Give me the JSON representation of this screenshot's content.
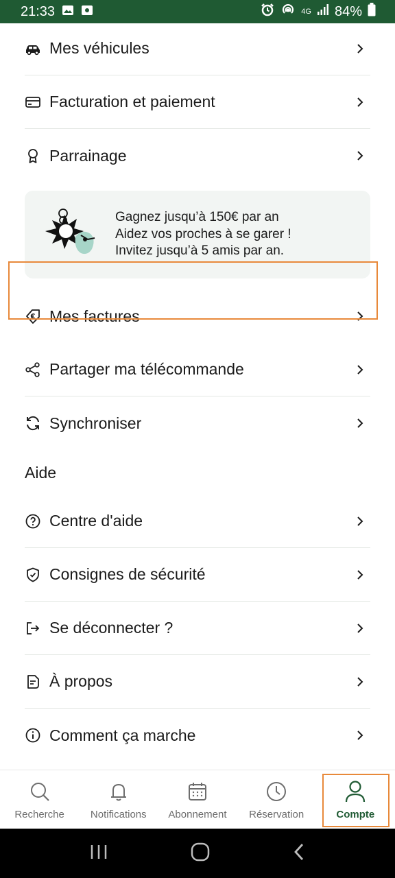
{
  "statusbar": {
    "time": "21:33",
    "network": "4G",
    "battery": "84%"
  },
  "menu": {
    "vehicles": "Mes véhicules",
    "billing": "Facturation et paiement",
    "referral": "Parrainage",
    "invoices": "Mes factures",
    "share_remote": "Partager ma télécommande",
    "sync": "Synchroniser"
  },
  "promo": {
    "line1": "Gagnez jusqu’à 150€ par an",
    "line2": "Aidez vos proches à se garer !",
    "line3": "Invitez jusqu’à 5 amis par an."
  },
  "help": {
    "title": "Aide",
    "center": "Centre d'aide",
    "safety": "Consignes de sécurité",
    "logout": "Se déconnecter ?",
    "about": "À propos",
    "how": "Comment ça marche"
  },
  "bottomnav": {
    "search": "Recherche",
    "notifications": "Notifications",
    "subscription": "Abonnement",
    "reservation": "Réservation",
    "account": "Compte"
  },
  "colors": {
    "brand": "#1f5a33",
    "highlight": "#e8893a",
    "accent_teal": "#a7d5c8"
  }
}
